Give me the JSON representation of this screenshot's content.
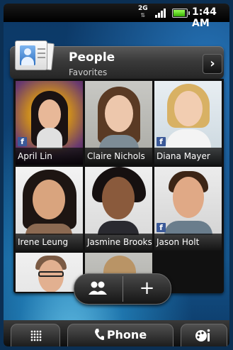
{
  "status_bar": {
    "network": "2G",
    "network_arrows": "⇅",
    "battery_level": 0.9,
    "time": "1:44 AM"
  },
  "widget": {
    "title": "People",
    "subtitle": "Favorites",
    "arrow_icon": "chevron-right-icon"
  },
  "contacts": [
    {
      "name": "April Lin",
      "facebook": true
    },
    {
      "name": "Claire Nichols",
      "facebook": false
    },
    {
      "name": "Diana Mayer",
      "facebook": true
    },
    {
      "name": "Irene Leung",
      "facebook": false
    },
    {
      "name": "Jasmine Brooks",
      "facebook": false
    },
    {
      "name": "Jason Holt",
      "facebook": true
    }
  ],
  "facebook_glyph": "f",
  "floating_buttons": {
    "groups_icon": "group-icon",
    "add_label": "+"
  },
  "dock": {
    "apps_icon": "app-grid-icon",
    "phone_label": "Phone",
    "personalize_icon": "personalize-icon"
  },
  "colors": {
    "facebook": "#3b5998",
    "battery": "#35b000"
  }
}
